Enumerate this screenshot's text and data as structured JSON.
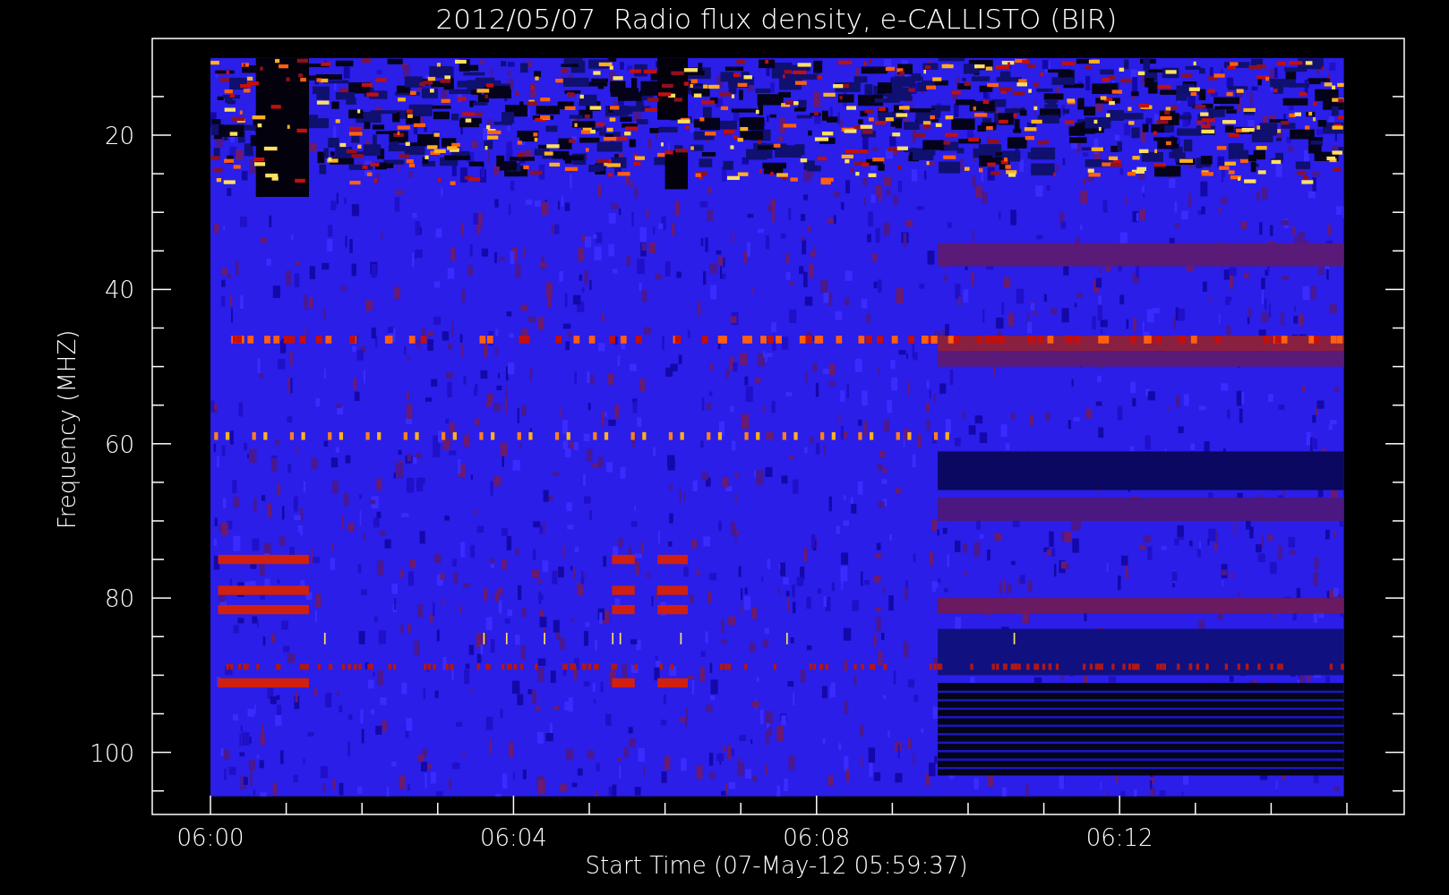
{
  "title": "2012/05/07  Radio flux density, e-CALLISTO (BIR)",
  "ylabel": "Frequency (MHZ)",
  "xlabel": "Start Time (07-May-12 05:59:37)",
  "yticks": [
    "20",
    "40",
    "60",
    "80",
    "100"
  ],
  "xticks": [
    "06:00",
    "06:04",
    "06:08",
    "06:12"
  ]
}
